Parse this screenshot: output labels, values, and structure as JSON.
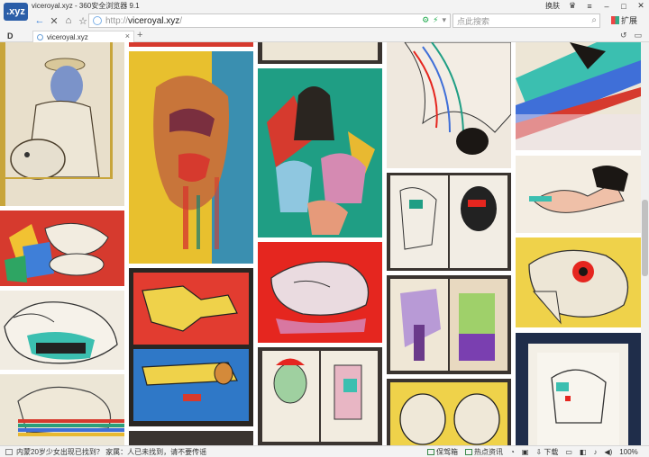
{
  "window": {
    "title": "viceroyal.xyz - 360安全浏览器 9.1",
    "logo_text": ".xyz",
    "right_label": "换肤"
  },
  "nav": {
    "url_protocol": "http://",
    "url_host": "viceroyal.xyz",
    "url_path": "/",
    "search_placeholder": "点此搜索",
    "extensions_label": "扩展"
  },
  "tabs": {
    "left_label": "D",
    "items": [
      {
        "label": "viceroyal.xyz"
      }
    ]
  },
  "status": {
    "message": "内蒙20岁少女出现已找到？ 家属：人已未找到，请不要传谣",
    "items": [
      "保驾箱",
      "热点资讯",
      "下载",
      "100%"
    ]
  },
  "gallery": {
    "colors": {
      "red": "#d63a2e",
      "teal": "#1f9e84",
      "yellow": "#efd24a",
      "cream": "#ede6d6",
      "navy": "#1f2d4a"
    }
  }
}
